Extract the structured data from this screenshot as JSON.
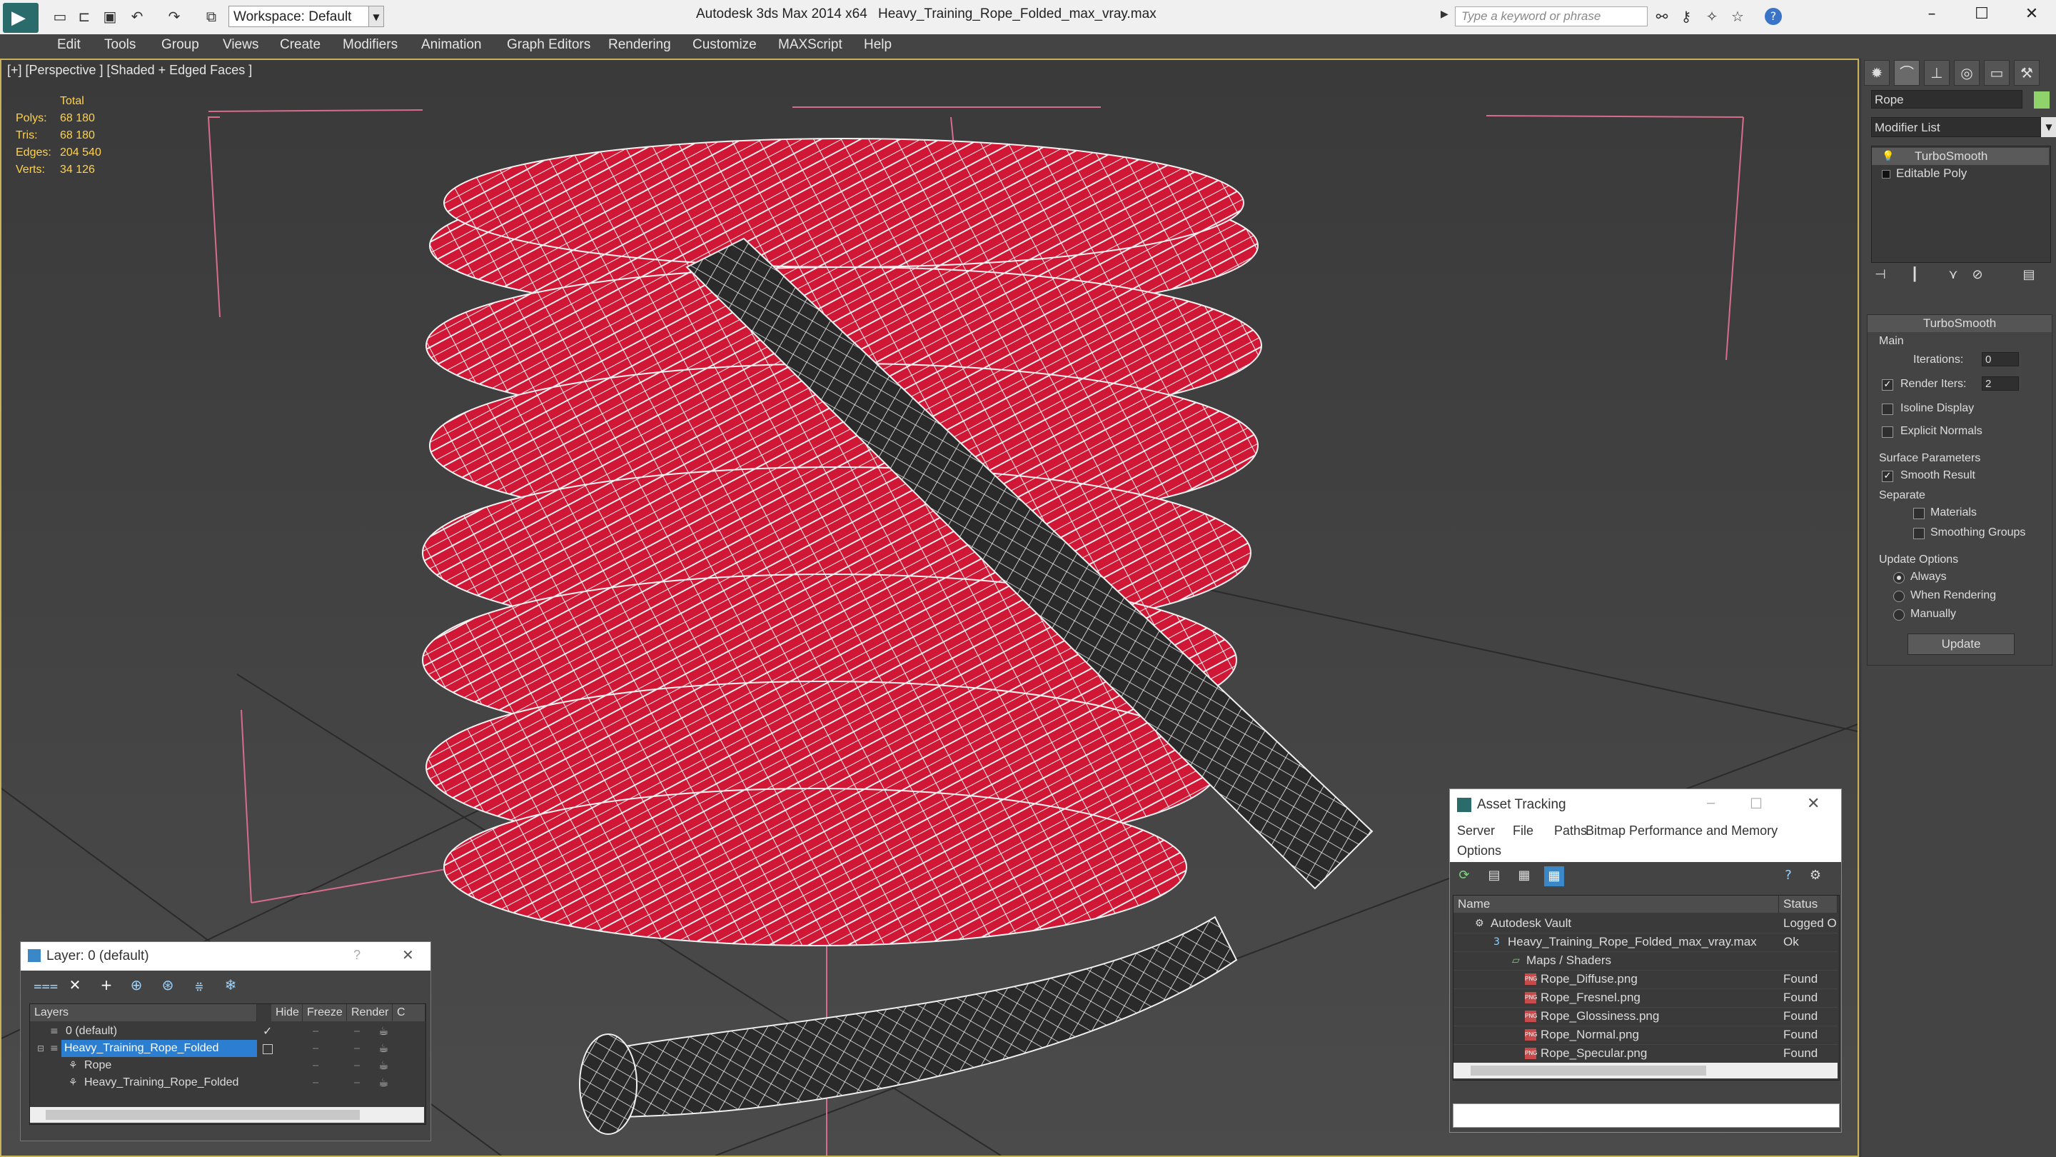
{
  "titlebar": {
    "workspace": "Workspace: Default",
    "app_title": "Autodesk 3ds Max  2014 x64",
    "file_title": "Heavy_Training_Rope_Folded_max_vray.max",
    "search_placeholder": "Type a keyword or phrase",
    "icons": [
      "new-icon",
      "open-icon",
      "save-icon",
      "undo-icon",
      "redo-icon",
      "project-icon"
    ],
    "search_tools": [
      "binoculars-icon",
      "key-icon",
      "star-x-icon",
      "star-icon",
      "help-icon"
    ]
  },
  "menubar": {
    "items": [
      "Edit",
      "Tools",
      "Group",
      "Views",
      "Create",
      "Modifiers",
      "Animation",
      "Graph Editors",
      "Rendering",
      "Customize",
      "MAXScript",
      "Help"
    ]
  },
  "viewport": {
    "label": "[+] [Perspective ] [Shaded + Edged Faces ]",
    "stats": {
      "header": "Total",
      "rows": [
        {
          "label": "Polys:",
          "value": "68 180"
        },
        {
          "label": "Tris:",
          "value": "68 180"
        },
        {
          "label": "Edges:",
          "value": "204 540"
        },
        {
          "label": "Verts:",
          "value": "34 126"
        }
      ]
    },
    "colors": {
      "rope_red": "#d01836",
      "rope_dark": "#2a2a2a",
      "wire": "#f2f2f2",
      "frame": "#d86c8c"
    }
  },
  "command_panel": {
    "object_name": "Rope",
    "object_color": "#8fd36a",
    "modifier_list": "Modifier List",
    "stack": [
      "TurboSmooth",
      "Editable Poly"
    ],
    "rollout_title": "TurboSmooth",
    "main_group": "Main",
    "iterations_label": "Iterations:",
    "iterations_value": "0",
    "render_iters_label": "Render Iters:",
    "render_iters_value": "2",
    "isoline": "Isoline Display",
    "explicit_normals": "Explicit Normals",
    "surface_params": "Surface Parameters",
    "smooth_result": "Smooth Result",
    "separate": "Separate",
    "materials": "Materials",
    "smoothing_groups": "Smoothing Groups",
    "update_options": "Update Options",
    "always": "Always",
    "when_rendering": "When Rendering",
    "manually": "Manually",
    "update_button": "Update"
  },
  "layer_dialog": {
    "title": "Layer: 0 (default)",
    "help": "?",
    "close": "✕",
    "columns": [
      "Layers",
      "Hide",
      "Freeze",
      "Render",
      "C"
    ],
    "rows": [
      {
        "name": "0 (default)",
        "indent": 0
      },
      {
        "name": "Heavy_Training_Rope_Folded",
        "indent": 0,
        "selected": true
      },
      {
        "name": "Rope",
        "indent": 1
      },
      {
        "name": "Heavy_Training_Rope_Folded",
        "indent": 1
      }
    ]
  },
  "asset_dialog": {
    "title": "Asset Tracking",
    "menu": [
      "Server",
      "File",
      "Paths",
      "Bitmap Performance and Memory",
      "Options"
    ],
    "columns": [
      "Name",
      "Status"
    ],
    "rows": [
      {
        "name": "Autodesk Vault",
        "status": "Logged O",
        "indent": 0
      },
      {
        "name": "Heavy_Training_Rope_Folded_max_vray.max",
        "status": "Ok",
        "indent": 1
      },
      {
        "name": "Maps / Shaders",
        "status": "",
        "indent": 2
      },
      {
        "name": "Rope_Diffuse.png",
        "status": "Found",
        "indent": 3
      },
      {
        "name": "Rope_Fresnel.png",
        "status": "Found",
        "indent": 3
      },
      {
        "name": "Rope_Glossiness.png",
        "status": "Found",
        "indent": 3
      },
      {
        "name": "Rope_Normal.png",
        "status": "Found",
        "indent": 3
      },
      {
        "name": "Rope_Specular.png",
        "status": "Found",
        "indent": 3
      }
    ]
  }
}
